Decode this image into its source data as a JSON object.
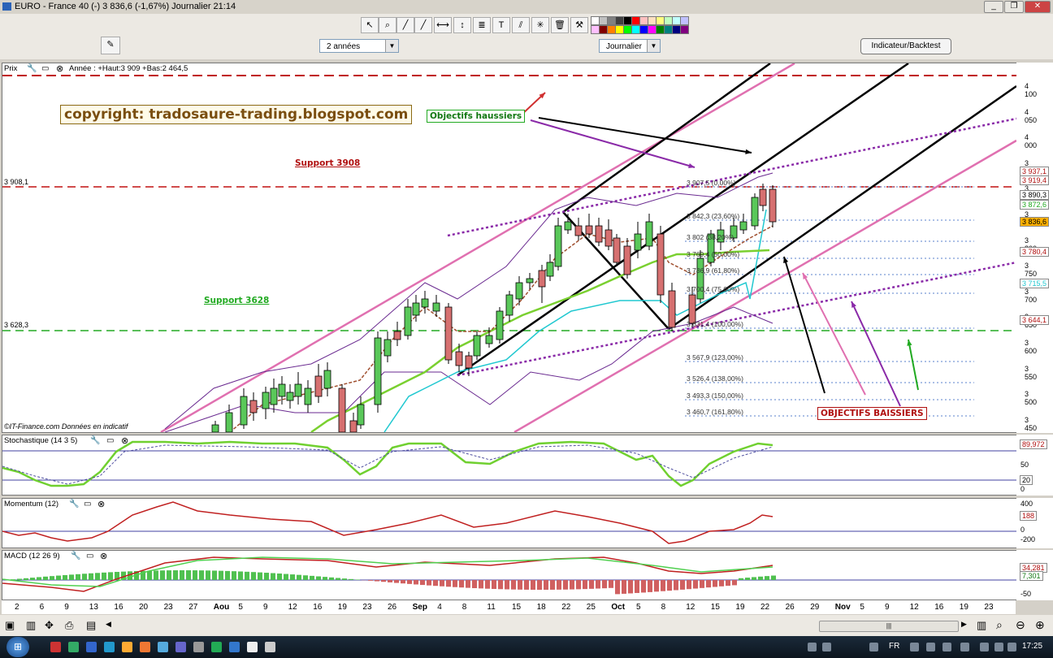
{
  "window": {
    "title": "EURO - France 40 (-)   3 836,6 (-1,67%)   Journalier  21:14"
  },
  "toolbar": {
    "period": "2 années",
    "interval": "Journalier",
    "indicator_button": "Indicateur/Backtest",
    "palette_colors": [
      "#ffffff",
      "#c0c0c0",
      "#808080",
      "#404040",
      "#000000",
      "#ff0000",
      "#ffc0c0",
      "#ffe0c0",
      "#ffff80",
      "#c0ffc0",
      "#c0ffff",
      "#c0c0ff",
      "#ffc0ff",
      "#800000",
      "#ff8000",
      "#ffff00",
      "#00ff00",
      "#00ffff",
      "#0000ff",
      "#ff00ff",
      "#008000",
      "#008080",
      "#000080",
      "#800080"
    ]
  },
  "main_panel": {
    "title": "Prix",
    "info": "Année : +Haut:3 909 +Bas:2 464,5",
    "copyright": "copyright: tradosaure-trading.blogspot.com",
    "source": "©IT-Finance.com  Données en indicatif",
    "support_top_label": "Support 3908",
    "support_bottom_label": "Support 3628",
    "support_top_value": "3 908,1",
    "support_bottom_value": "3 628,3",
    "objectives_up": "Objectifs haussiers",
    "objectives_down": "OBJECTIFS BAISSIERS",
    "fib_levels": [
      "3 907,5 (0,00%)",
      "3 842,3 (23,60%)",
      "3 802 (38,20%)",
      "3 769,4 (50,00%)",
      "3 736,9 (61,80%)",
      "3 700,4 (75,00%)",
      "3 631,4 (100,00%)",
      "3 567,9 (123,00%)",
      "3 526,4 (138,00%)",
      "3 493,3 (150,00%)",
      "3 460,7 (161,80%)"
    ],
    "y_ticks": [
      "4 100",
      "4 050",
      "4 000",
      "3 950",
      "3 900",
      "3 850",
      "3 800",
      "3 750",
      "3 700",
      "3 650",
      "3 600",
      "3 550",
      "3 500",
      "3 450"
    ],
    "tags": [
      "3 937,1",
      "3 919,4",
      "3 890,3",
      "3 872,6",
      "3 836,6",
      "3 780,4",
      "3 715,5",
      "3 644,1"
    ]
  },
  "stochastic": {
    "title": "Stochastique (14 3 5)",
    "ticks": [
      "50",
      "0"
    ],
    "tag": "89,972",
    "level": "20"
  },
  "momentum": {
    "title": "Momentum (12)",
    "ticks": [
      "400",
      "0",
      "-200"
    ],
    "tag": "188"
  },
  "macd": {
    "title": "MACD (12 26 9)",
    "ticks": [
      "-50"
    ],
    "tag1": "34,281",
    "tag2": "7,301"
  },
  "x_axis": [
    "2",
    "6",
    "9",
    "13",
    "16",
    "20",
    "23",
    "27",
    "Aou",
    "5",
    "9",
    "12",
    "16",
    "19",
    "23",
    "26",
    "Sep",
    "4",
    "8",
    "11",
    "15",
    "18",
    "22",
    "25",
    "Oct",
    "5",
    "8",
    "12",
    "15",
    "19",
    "22",
    "26",
    "29",
    "Nov",
    "5",
    "9",
    "12",
    "16",
    "19",
    "23"
  ],
  "taskbar": {
    "lang": "FR",
    "clock": "17:25"
  }
}
